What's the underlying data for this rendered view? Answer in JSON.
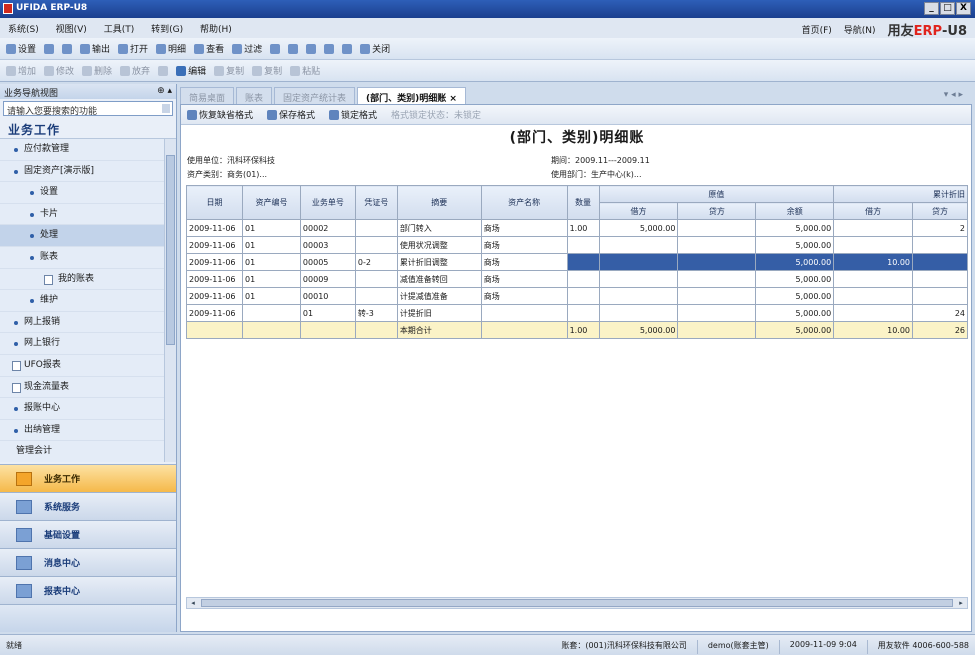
{
  "window": {
    "title": "UFIDA ERP-U8",
    "btn_min": "_",
    "btn_max": "□",
    "btn_close": "X"
  },
  "menu": {
    "items": [
      "系统(S)",
      "视图(V)",
      "工具(T)",
      "转到(G)",
      "帮助(H)"
    ],
    "home": "首页(F)",
    "nav": "导航(N)",
    "brand_prefix": "用友",
    "brand_erp": "ERP",
    "brand_suffix": "-U8"
  },
  "toolbar1": [
    "设置",
    "",
    "输出",
    "打开",
    "明细",
    "查看",
    "过滤",
    "",
    "",
    "",
    "",
    "",
    "关闭"
  ],
  "toolbar2": [
    "增加",
    "修改",
    "删除",
    "放弃",
    "",
    "编辑",
    "复制",
    "复制",
    "粘贴"
  ],
  "left": {
    "header": "业务导航视图",
    "pin": "⊕ ▴",
    "search_placeholder": "请输入您要搜索的功能",
    "section": "业务工作",
    "tree": [
      {
        "label": "应付款管理",
        "level": 1
      },
      {
        "label": "固定资产[演示版]",
        "level": 1
      },
      {
        "label": "设置",
        "level": 2
      },
      {
        "label": "卡片",
        "level": 2
      },
      {
        "label": "处理",
        "level": 2
      },
      {
        "label": "账表",
        "level": 2
      },
      {
        "label": "我的账表",
        "level": 3
      },
      {
        "label": "维护",
        "level": 2
      },
      {
        "label": "网上报销",
        "level": 1
      },
      {
        "label": "网上银行",
        "level": 1
      },
      {
        "label": "UFO报表",
        "level": 1
      },
      {
        "label": "现金流量表",
        "level": 1
      },
      {
        "label": "报账中心",
        "level": 1
      },
      {
        "label": "出纳管理",
        "level": 1
      },
      {
        "label": "管理会计",
        "level": 0
      }
    ],
    "modules": [
      "业务工作",
      "系统服务",
      "基础设置",
      "消息中心",
      "报表中心"
    ]
  },
  "tabs": [
    "简易桌面",
    "账表",
    "固定资产统计表",
    "(部门、类别)明细账"
  ],
  "tab_close": "×",
  "tab_nav": "▾ ◂ ▸",
  "report": {
    "toolbar": [
      "恢复缺省格式",
      "保存格式",
      "锁定格式",
      "格式锁定状态：未锁定"
    ],
    "title": "(部门、类别)明细账",
    "unit_label": "使用单位：汛科环保科技",
    "period_label": "期间：2009.11---2009.11",
    "category_label": "资产类别：商务(01)...",
    "dept_label": "使用部门：生产中心(k)...",
    "headers": [
      "日期",
      "资产编号",
      "业务单号",
      "凭证号",
      "摘要",
      "资产名称",
      "数量"
    ],
    "group_original": "原值",
    "group_acc": "累计折旧",
    "sub": [
      "借方",
      "贷方",
      "余额",
      "借方",
      "贷方"
    ],
    "rows": [
      [
        "2009-11-06",
        "01",
        "00002",
        "",
        "部门转入",
        "商场",
        "1.00",
        "5,000.00",
        "",
        "5,000.00",
        "",
        "2"
      ],
      [
        "2009-11-06",
        "01",
        "00003",
        "",
        "使用状况调整",
        "商场",
        "",
        "",
        "",
        "5,000.00",
        "",
        ""
      ],
      [
        "2009-11-06",
        "01",
        "00005",
        "0-2",
        "累计折旧调整",
        "商场",
        "",
        "",
        "",
        "5,000.00",
        "10.00",
        ""
      ],
      [
        "2009-11-06",
        "01",
        "00009",
        "",
        "减值准备转回",
        "商场",
        "",
        "",
        "",
        "5,000.00",
        "",
        ""
      ],
      [
        "2009-11-06",
        "01",
        "00010",
        "",
        "计提减值准备",
        "商场",
        "",
        "",
        "",
        "5,000.00",
        "",
        ""
      ],
      [
        "2009-11-06",
        "",
        "01",
        "转-3",
        "计提折旧",
        "",
        "",
        "",
        "",
        "5,000.00",
        "",
        "24"
      ]
    ],
    "total": [
      "",
      "",
      "",
      "",
      "本期合计",
      "",
      "1.00",
      "5,000.00",
      "",
      "5,000.00",
      "10.00",
      "26"
    ]
  },
  "status": {
    "left": "就绪",
    "account": "账套：(001)汛科环保科技有限公司",
    "user": "demo(账套主管)",
    "date": "2009-11-09 9:04",
    "vendor": "用友软件 4006-600-588"
  }
}
